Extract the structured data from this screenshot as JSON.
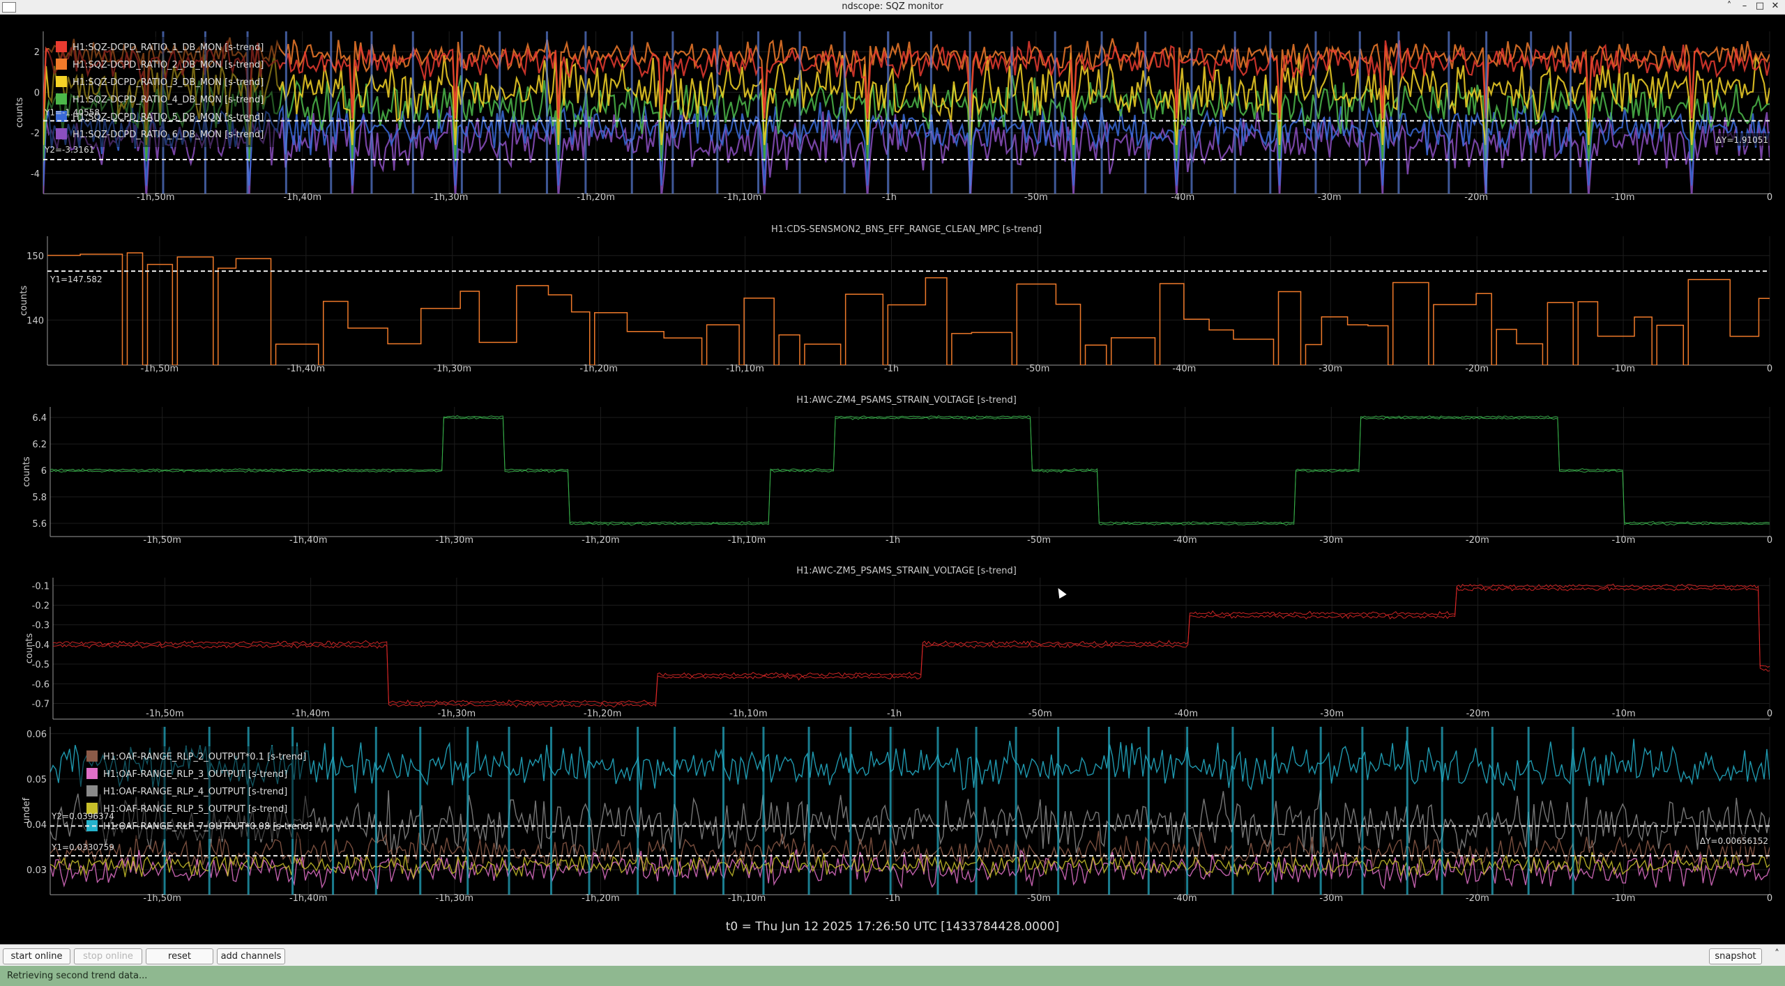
{
  "window": {
    "title": "ndscope: SQZ monitor"
  },
  "xticks": [
    "-1h,50m",
    "-1h,40m",
    "-1h,30m",
    "-1h,20m",
    "-1h,10m",
    "-1h",
    "-50m",
    "-40m",
    "-30m",
    "-20m",
    "-10m",
    "0"
  ],
  "xtick_values": [
    -6600,
    -6000,
    -5400,
    -4800,
    -4200,
    -3600,
    -3000,
    -2400,
    -1800,
    -1200,
    -600,
    0
  ],
  "xlim": [
    -7060,
    0
  ],
  "plots": [
    {
      "id": "sqz-dcpd",
      "title": "",
      "ylabel": "counts",
      "ylim": [
        -5,
        3
      ],
      "yticks": [
        2,
        0,
        -2,
        -4
      ],
      "legend": [
        {
          "label": "H1:SQZ-DCPD_RATIO_1_DB_MON [s-trend]",
          "color": "#e83b30"
        },
        {
          "label": "H1:SQZ-DCPD_RATIO_2_DB_MON [s-trend]",
          "color": "#f07a2a"
        },
        {
          "label": "H1:SQZ-DCPD_RATIO_3_DB_MON [s-trend]",
          "color": "#f5d327"
        },
        {
          "label": "H1:SQZ-DCPD_RATIO_4_DB_MON [s-trend]",
          "color": "#4cb84a"
        },
        {
          "label": "H1:SQZ-DCPD_RATIO_5_DB_MON [s-trend]",
          "color": "#3a6ad8"
        },
        {
          "label": "H1:SQZ-DCPD_RATIO_6_DB_MON [s-trend]",
          "color": "#8b4fbf"
        }
      ],
      "cursors": {
        "y1": "Y1=-1.40558",
        "y2": "Y2=-3.3161",
        "dy": "ΔY=1.91051",
        "y1_value": -1.40558,
        "y2_value": -3.3161
      }
    },
    {
      "id": "cds-range",
      "title": "H1:CDS-SENSMON2_BNS_EFF_RANGE_CLEAN_MPC [s-trend]",
      "ylabel": "counts",
      "ylim": [
        133,
        153
      ],
      "yticks": [
        150,
        140
      ],
      "color": "#f07a2a",
      "cursors": {
        "y1": "Y1=147.582",
        "y1_value": 147.582
      }
    },
    {
      "id": "zm4",
      "title": "H1:AWC-ZM4_PSAMS_STRAIN_VOLTAGE [s-trend]",
      "ylabel": "counts",
      "ylim": [
        5.5,
        6.48
      ],
      "yticks": [
        6.4,
        6.2,
        6,
        5.8,
        5.6
      ],
      "color": "#37b34a"
    },
    {
      "id": "zm5",
      "title": "H1:AWC-ZM5_PSAMS_STRAIN_VOLTAGE [s-trend]",
      "ylabel": "counts",
      "ylim": [
        -0.78,
        -0.06
      ],
      "yticks": [
        -0.1,
        -0.2,
        -0.3,
        -0.4,
        -0.5,
        -0.6,
        -0.7
      ],
      "color": "#e02828"
    },
    {
      "id": "oaf-range",
      "title": "",
      "ylabel": "undef",
      "ylim": [
        0.0245,
        0.0615
      ],
      "yticks": [
        0.06,
        0.05,
        0.04,
        0.03
      ],
      "legend": [
        {
          "label": "H1:OAF-RANGE_RLP_2_OUTPUT*0.1 [s-trend]",
          "color": "#8c5a48"
        },
        {
          "label": "H1:OAF-RANGE_RLP_3_OUTPUT [s-trend]",
          "color": "#e070c8"
        },
        {
          "label": "H1:OAF-RANGE_RLP_4_OUTPUT [s-trend]",
          "color": "#8a8a8a"
        },
        {
          "label": "H1:OAF-RANGE_RLP_5_OUTPUT [s-trend]",
          "color": "#c8bf2a"
        },
        {
          "label": "H1:OAF-RANGE_RLP_7_OUTPUT*0.08 [s-trend]",
          "color": "#25b3cc"
        }
      ],
      "cursors": {
        "y1": "Y1=0.0330759",
        "y2": "Y2=0.0396374",
        "dy": "ΔY=0.00656152",
        "y1_value": 0.0330759,
        "y2_value": 0.0396374
      }
    }
  ],
  "t0": "t0 = Thu Jun 12 2025 17:26:50 UTC [1433784428.0000]",
  "toolbar": {
    "start_online": "start online",
    "stop_online": "stop online",
    "reset": "reset",
    "add_channels": "add channels",
    "snapshot": "snapshot"
  },
  "status": "Retrieving second trend data..."
}
